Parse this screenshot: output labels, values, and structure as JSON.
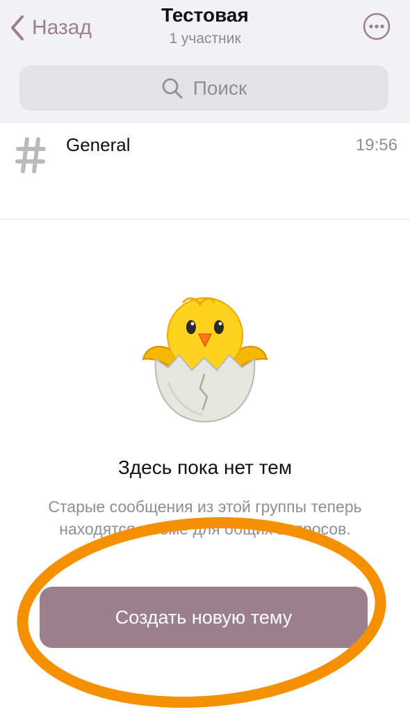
{
  "header": {
    "back_label": "Назад",
    "title": "Тестовая",
    "subtitle": "1 участник",
    "back_icon": "chevron-left-icon",
    "more_icon": "more-icon"
  },
  "search": {
    "placeholder": "Поиск",
    "icon": "search-icon"
  },
  "topics": [
    {
      "icon": "hash-icon",
      "name": "General",
      "time": "19:56"
    }
  ],
  "empty_state": {
    "illustration": "hatching-chick-icon",
    "title": "Здесь пока нет тем",
    "description": "Старые сообщения из этой группы теперь находятся в теме для общих вопросов.",
    "button_label": "Создать новую тему"
  },
  "colors": {
    "accent": "#9c7f8d",
    "highlight": "#f59100"
  }
}
